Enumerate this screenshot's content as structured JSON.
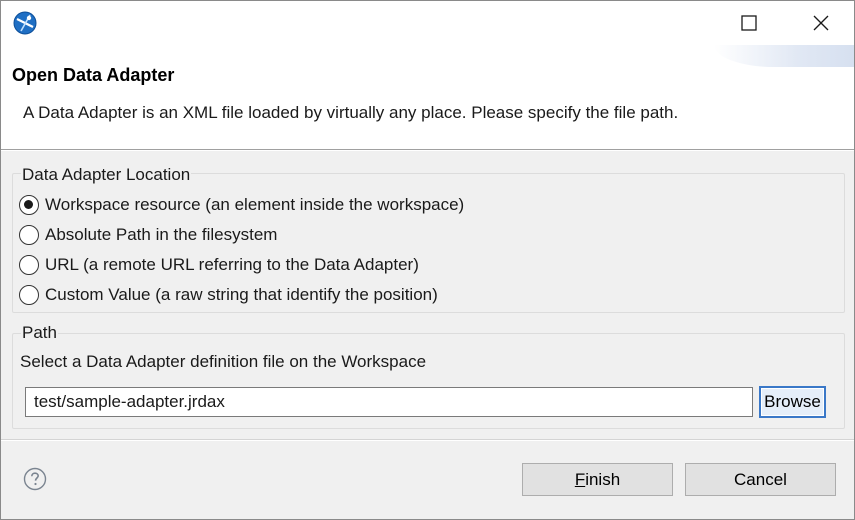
{
  "header": {
    "title": "Open Data Adapter",
    "description": "A Data Adapter is an XML file loaded by virtually any place. Please specify the file path."
  },
  "location_group": {
    "label": "Data Adapter Location",
    "selected_index": 0,
    "options": [
      {
        "label": "Workspace resource (an element inside the workspace)",
        "checked": true
      },
      {
        "label": "Absolute Path in the filesystem",
        "checked": false
      },
      {
        "label": "URL (a remote URL referring to the Data Adapter)",
        "checked": false
      },
      {
        "label": "Custom Value (a raw string that identify the position)",
        "checked": false
      }
    ]
  },
  "path_group": {
    "label": "Path",
    "description": "Select a Data Adapter definition file on the Workspace",
    "value": "test/sample-adapter.jrdax",
    "browse_label": "Browse"
  },
  "footer": {
    "finish_first": "F",
    "finish_rest": "inish",
    "cancel_label": "Cancel"
  },
  "icons": {
    "app": "jaspersoft-app-icon",
    "help": "help-icon",
    "minimize": "minimize-icon",
    "maximize": "maximize-icon",
    "close": "close-icon"
  },
  "colors": {
    "focus_border": "#3a78c8",
    "dialog_background": "#f0f0f0"
  }
}
